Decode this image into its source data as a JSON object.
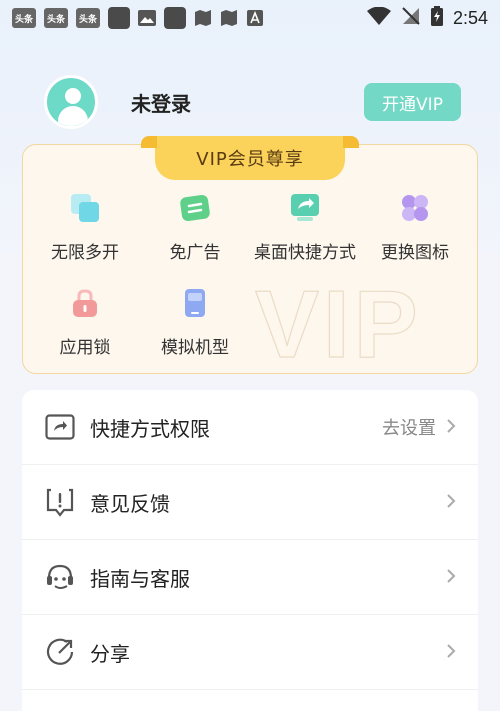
{
  "status_bar": {
    "time": "2:54",
    "notif_labels": [
      "头条",
      "头条",
      "头条"
    ],
    "icons": [
      "toutiao-icon",
      "toutiao-icon",
      "toutiao-icon",
      "app-icon",
      "image-icon",
      "app-icon",
      "map-icon",
      "map-icon",
      "font-icon"
    ]
  },
  "profile": {
    "username": "未登录",
    "vip_button": "开通VIP"
  },
  "vip_card": {
    "title": "VIP会员尊享",
    "features": [
      {
        "label": "无限多开",
        "icon": "copies-icon",
        "color": "#6fd7e6"
      },
      {
        "label": "免广告",
        "icon": "no-ads-icon",
        "color": "#5fd08a"
      },
      {
        "label": "桌面快捷方式",
        "icon": "shortcut-icon",
        "color": "#58cfae"
      },
      {
        "label": "更换图标",
        "icon": "clover-icon",
        "color": "#b596ee"
      },
      {
        "label": "应用锁",
        "icon": "lock-icon",
        "color": "#f29a9a"
      },
      {
        "label": "模拟机型",
        "icon": "phone-icon",
        "color": "#8ea9f2"
      }
    ]
  },
  "menu": {
    "items": [
      {
        "label": "快捷方式权限",
        "value": "去设置",
        "icon": "shortcut-permission-icon"
      },
      {
        "label": "意见反馈",
        "value": "",
        "icon": "feedback-icon"
      },
      {
        "label": "指南与客服",
        "value": "",
        "icon": "support-icon"
      },
      {
        "label": "分享",
        "value": "",
        "icon": "share-icon"
      }
    ]
  }
}
